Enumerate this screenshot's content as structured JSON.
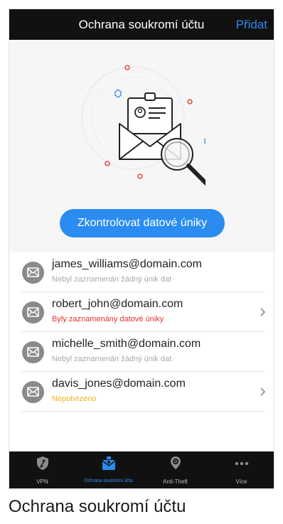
{
  "navbar": {
    "title": "Ochrana soukromí účtu",
    "add_label": "Přidat"
  },
  "hero": {
    "button_label": "Zkontrolovat datové úniky"
  },
  "accounts": [
    {
      "email": "james_williams@domain.com",
      "status": "Nebyl zaznamenán žádný únik dat",
      "status_color": "#a9a9a9",
      "chevron": false
    },
    {
      "email": "robert_john@domain.com",
      "status": "Byly zaznamenány datové úniky",
      "status_color": "#e0332c",
      "chevron": true
    },
    {
      "email": "michelle_smith@domain.com",
      "status": "Nebyl zaznamenán žádný únik dat",
      "status_color": "#a9a9a9",
      "chevron": false
    },
    {
      "email": "davis_jones@domain.com",
      "status": "Nepotvrzeno",
      "status_color": "#f2b01e",
      "chevron": true
    }
  ],
  "tabbar": {
    "tabs": [
      {
        "label": "VPN",
        "icon": "vpn-shield-icon"
      },
      {
        "label": "Ochrana soukromí účtu",
        "icon": "account-privacy-icon",
        "active": true
      },
      {
        "label": "Anti-Theft",
        "icon": "location-pin-icon"
      },
      {
        "label": "Více",
        "icon": "more-dots-icon"
      }
    ]
  },
  "caption": "Ochrana soukromí účtu",
  "colors": {
    "accent": "#2a8cf0",
    "bar": "#111111",
    "hero_bg": "#f6f6f6",
    "danger": "#e0332c",
    "warning": "#f2b01e"
  }
}
